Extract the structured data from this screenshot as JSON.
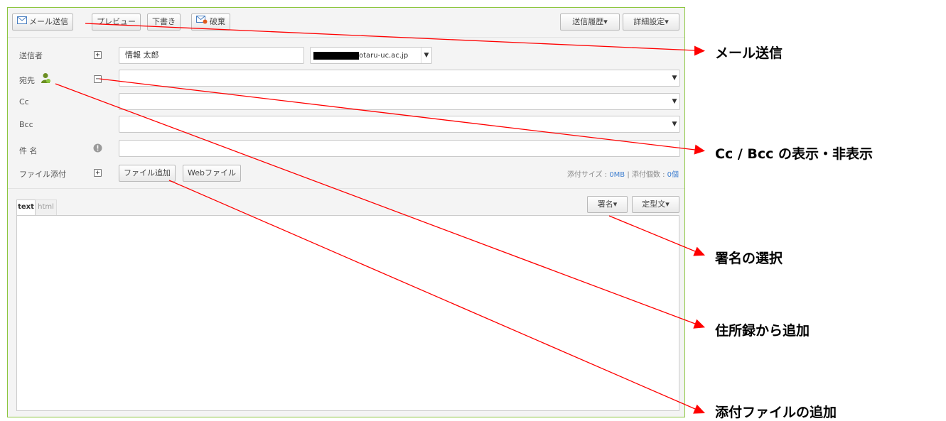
{
  "toolbar": {
    "send_label": "メール送信",
    "preview_label": "プレビュー",
    "draft_label": "下書き",
    "discard_label": "破棄",
    "history_label": "送信履歴▾",
    "settings_label": "詳細設定▾"
  },
  "form": {
    "sender_label": "送信者",
    "sender_name": "情報 太郎",
    "sender_domain": "otaru-uc.ac.jp",
    "to_label": "宛先",
    "cc_label": "Cc",
    "bcc_label": "Bcc",
    "subject_label": "件 名",
    "attach_label": "ファイル添付",
    "add_file_label": "ファイル追加",
    "web_file_label": "Webファイル",
    "attach_size_prefix": "添付サイズ : ",
    "attach_size_value": "0MB",
    "attach_count_prefix": " | 添付個数 : ",
    "attach_count_value": "0個"
  },
  "editor": {
    "tabs": [
      "text",
      "html"
    ],
    "signature_label": "署名▾",
    "template_label": "定型文▾"
  },
  "annotations": {
    "send": "メール送信",
    "cc_bcc": "Cc / Bcc の表示・非表示",
    "signature": "署名の選択",
    "address_book": "住所録から追加",
    "attachment": "添付ファイルの追加"
  },
  "colors": {
    "frame_border": "#8cc63f",
    "annotation_line": "#ff0000",
    "link_blue": "#3f7fd0"
  }
}
